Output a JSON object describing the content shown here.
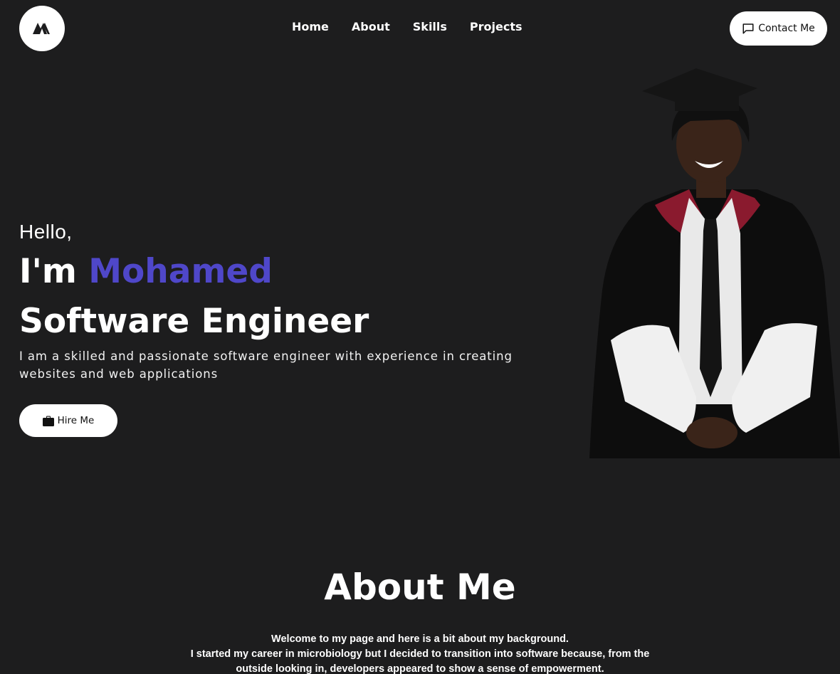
{
  "header": {
    "logo_icon": "mm-monogram-icon",
    "nav": [
      {
        "label": "Home"
      },
      {
        "label": "About"
      },
      {
        "label": "Skills"
      },
      {
        "label": "Projects"
      }
    ],
    "contact_label": "Contact Me",
    "contact_icon": "message-square-icon"
  },
  "hero": {
    "greeting": "Hello,",
    "name_prefix": "I'm ",
    "name": "Mohamed",
    "role": "Software Engineer",
    "intro": "I am a skilled and passionate software engineer with experience in creating websites and web applications",
    "hire_label": "Hire Me",
    "hire_icon": "briefcase-icon",
    "portrait": "graduation-portrait-photo"
  },
  "about": {
    "title": "About Me",
    "lines": [
      "Welcome to my page and here is a bit about my background.",
      "I started my career in microbiology but I decided to transition into software because, from the outside looking in, developers appeared to show a sense of empowerment."
    ]
  },
  "colors": {
    "background": "#1d1d1e",
    "accent": "#4f47c9",
    "button_bg": "#ffffff"
  }
}
